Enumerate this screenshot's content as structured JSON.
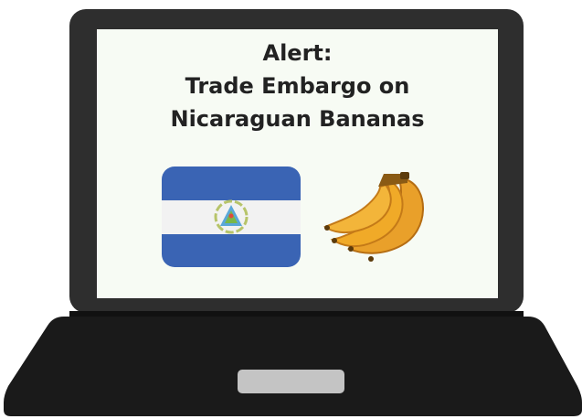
{
  "alert": {
    "line1": "Alert:",
    "line2": "Trade Embargo on",
    "line3": "Nicaraguan Bananas"
  },
  "colors": {
    "laptop_body": "#1a1a1a",
    "laptop_bezel": "#2e2e2e",
    "screen_bg": "#f7fbf4",
    "flag_blue": "#3a64b4",
    "flag_white": "#f2f2f2",
    "banana_yellow": "#f0aa28",
    "banana_shade": "#c87814",
    "trackpad": "#c4c4c4"
  },
  "icons": {
    "flag": "nicaragua-flag-icon",
    "fruit": "banana-bunch-icon"
  }
}
